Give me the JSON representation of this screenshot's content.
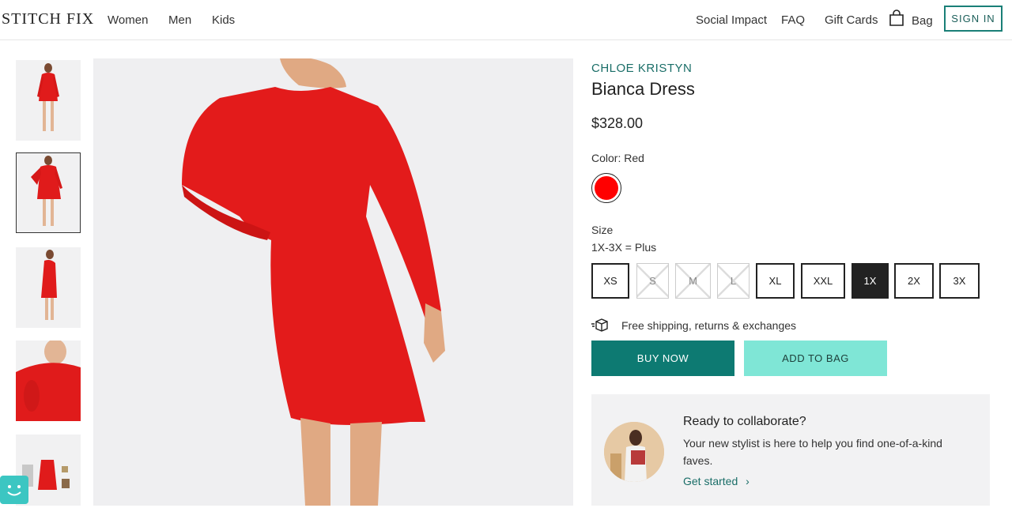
{
  "header": {
    "logo": "STITCH FIX",
    "nav": [
      "Women",
      "Men",
      "Kids"
    ],
    "right_links": [
      "Social Impact",
      "FAQ",
      "Gift Cards"
    ],
    "bag_label": "Bag",
    "bag_icon": "shopping-bag-icon",
    "signin_label": "SIGN IN"
  },
  "gallery": {
    "thumbnails": [
      "thumb-front",
      "thumb-back",
      "thumb-side",
      "thumb-detail",
      "thumb-outfit"
    ],
    "selected_index": 1
  },
  "product": {
    "brand": "CHLOE KRISTYN",
    "title": "Bianca Dress",
    "price": "$328.00",
    "color_label": "Color:",
    "color_value": "Red",
    "color_hex": "#ff0000",
    "size_label": "Size",
    "size_range": "1X-3X",
    "size_range_suffix": " = Plus",
    "sizes": [
      {
        "label": "XS",
        "state": "available"
      },
      {
        "label": "S",
        "state": "unavailable"
      },
      {
        "label": "M",
        "state": "unavailable"
      },
      {
        "label": "L",
        "state": "unavailable"
      },
      {
        "label": "XL",
        "state": "available"
      },
      {
        "label": "XXL",
        "state": "available"
      },
      {
        "label": "1X",
        "state": "selected"
      },
      {
        "label": "2X",
        "state": "available"
      },
      {
        "label": "3X",
        "state": "available"
      }
    ],
    "shipping_text": "Free shipping, returns & exchanges",
    "buy_now_label": "BUY NOW",
    "add_to_bag_label": "ADD TO BAG"
  },
  "promo": {
    "title": "Ready to collaborate?",
    "text": "Your new stylist is here to help you find one-of-a-kind faves.",
    "link": "Get started",
    "link_icon": "chevron-right-icon"
  },
  "colors": {
    "accent": "#0d7a72",
    "accent_light": "#7fe6d6",
    "brand_text": "#1a6e68"
  }
}
